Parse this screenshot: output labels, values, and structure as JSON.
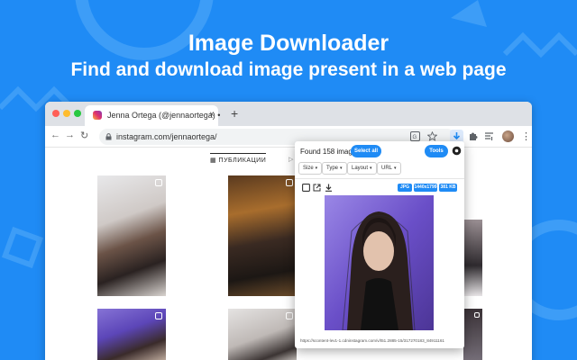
{
  "hero": {
    "title": "Image Downloader",
    "subtitle": "Find and download image present in a web page"
  },
  "browser": {
    "tab_title": "Jenna Ortega (@jennaortega) •",
    "tab_close": "×",
    "new_tab": "+",
    "url": "instagram.com/jennaortega/",
    "back": "←",
    "forward": "→",
    "reload": "↻",
    "menu": "⋮"
  },
  "instagram": {
    "publications_tab": "▦ ПУБЛИКАЦИИ",
    "reels_tab": "▷ R"
  },
  "extension": {
    "found_text": "Found 158 images",
    "select_all": "Select all",
    "tools": "Tools",
    "filters": [
      {
        "label": "Size"
      },
      {
        "label": "Type"
      },
      {
        "label": "Layout"
      },
      {
        "label": "URL"
      }
    ],
    "chevron": "▾",
    "preview": {
      "type_badge": "JPG",
      "dimensions_badge": "1440x1799",
      "size_badge": "381 KB",
      "url": "https://scontent-lev1-1.cdninstagram.com/v/t51.2885-15/317270183_84911161"
    }
  },
  "colors": {
    "background": "#1f8bf5",
    "accent": "#1f8bf5"
  }
}
